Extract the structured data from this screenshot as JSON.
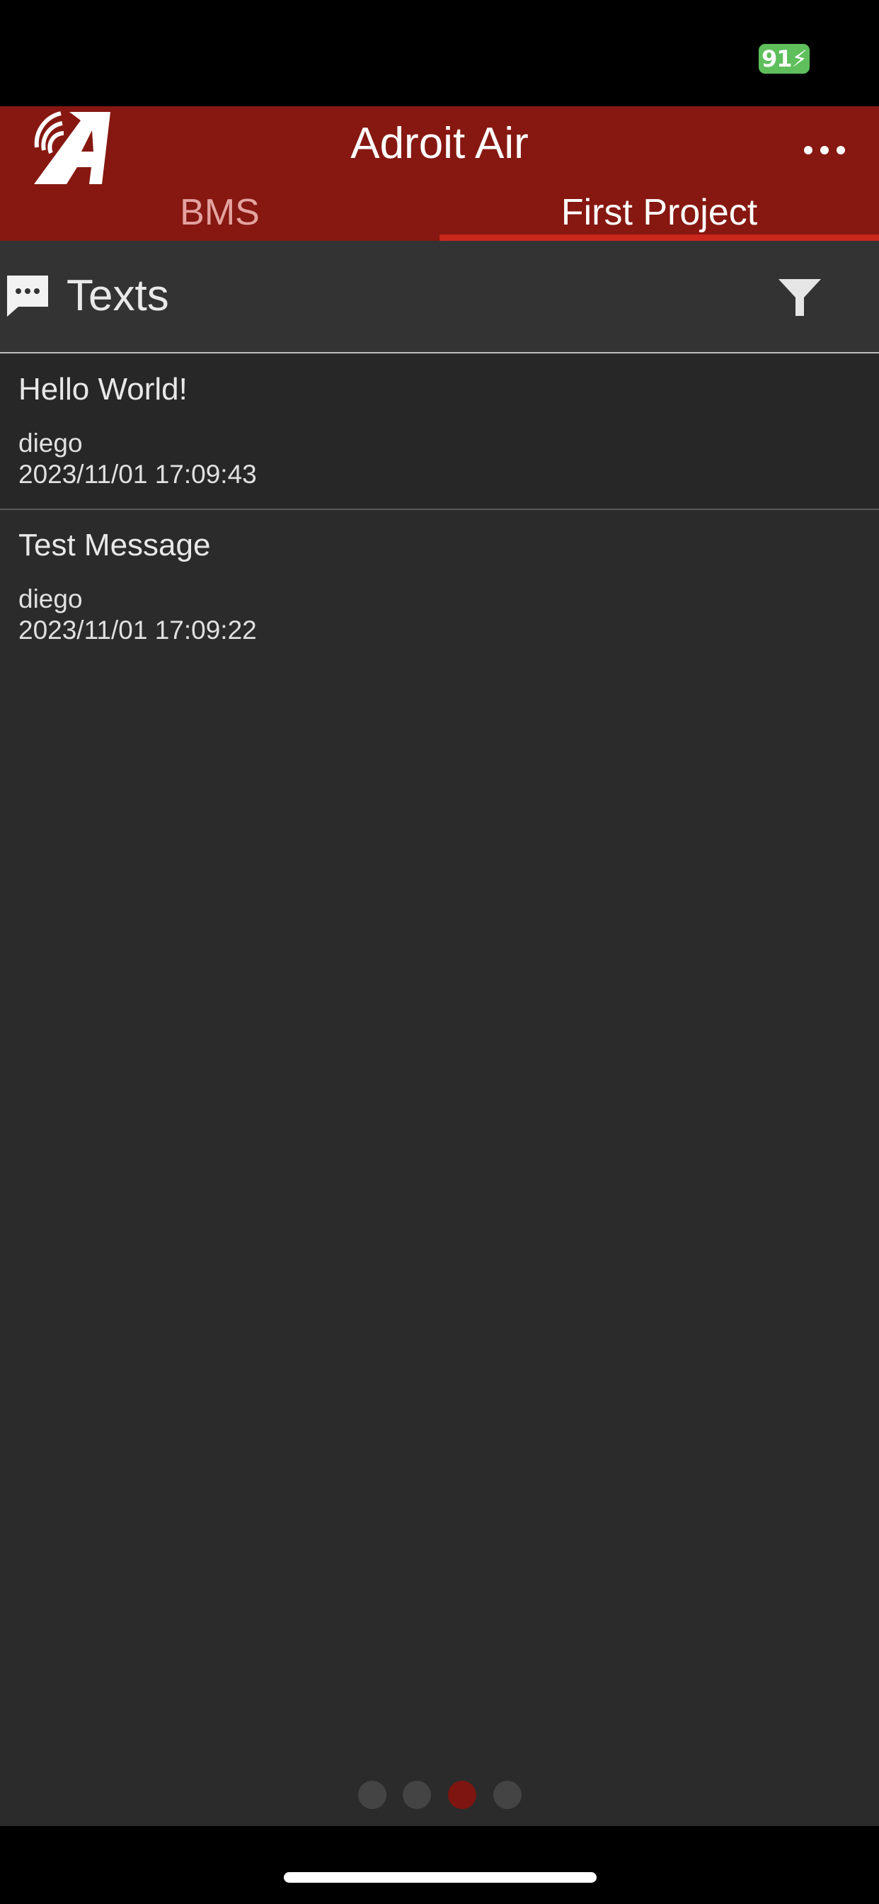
{
  "status_bar": {
    "battery_text": "91"
  },
  "header": {
    "title": "Adroit Air",
    "tabs": [
      {
        "label": "BMS",
        "active": false
      },
      {
        "label": "First Project",
        "active": true
      }
    ],
    "accent_color": "#861811"
  },
  "section": {
    "title": "Texts",
    "icon": "message-icon",
    "filter_icon": "filter-icon"
  },
  "messages": [
    {
      "title": "Hello World!",
      "author": "diego",
      "timestamp": "2023/11/01 17:09:43"
    },
    {
      "title": "Test Message",
      "author": "diego",
      "timestamp": "2023/11/01 17:09:22"
    }
  ],
  "pagination": {
    "total": 4,
    "active_index": 2
  }
}
